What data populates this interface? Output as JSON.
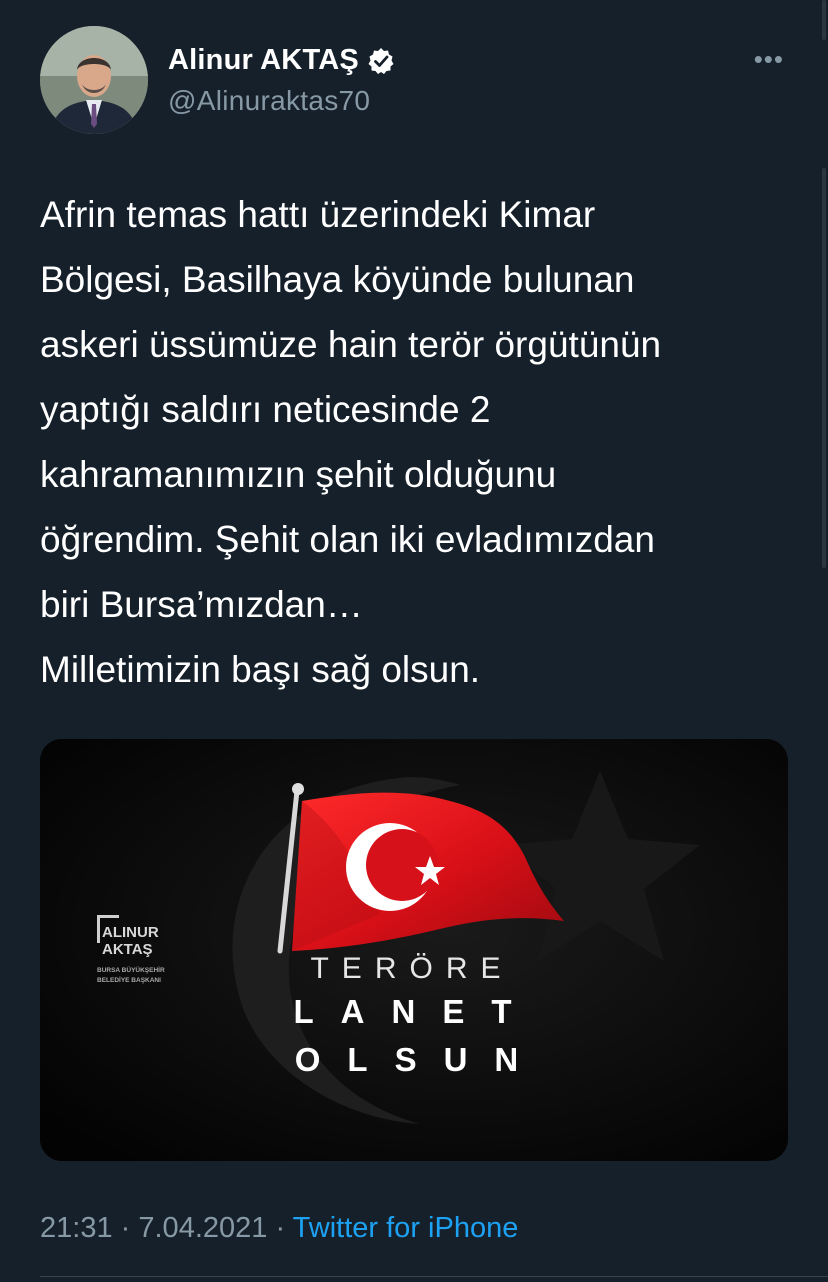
{
  "tweet": {
    "author": {
      "display_name": "Alinur AKTAŞ",
      "handle": "@Alinuraktas70",
      "verified": true
    },
    "more_icon": "more-horizontal-icon",
    "text": "Afrin temas hattı üzerindeki Kimar\nBölgesi, Basilhaya köyünde bulunan\naskeri üssümüze hain terör örgütünün\nyaptığı saldırı neticesinde 2\nkahramanımızın şehit olduğunu\nöğrendim. Şehit olan iki evladımızdan\nbiri Bursa’mızdan…\nMilletimizin başı sağ olsun.",
    "media": {
      "logo_line1": "ALINUR",
      "logo_line2": "AKTAŞ",
      "logo_sub1": "BURSA BÜYÜKŞEHİR",
      "logo_sub2": "BELEDİYE BAŞKANI",
      "headline1": "TERÖRE",
      "headline2": "LANET",
      "headline3": "OLSUN"
    },
    "time": "21:31",
    "date": "7.04.2021",
    "separator": "·",
    "source": "Twitter for iPhone"
  },
  "colors": {
    "background": "#15202b",
    "secondary_text": "#8899a6",
    "link": "#1da1f2",
    "flag_red": "#e30a17"
  }
}
